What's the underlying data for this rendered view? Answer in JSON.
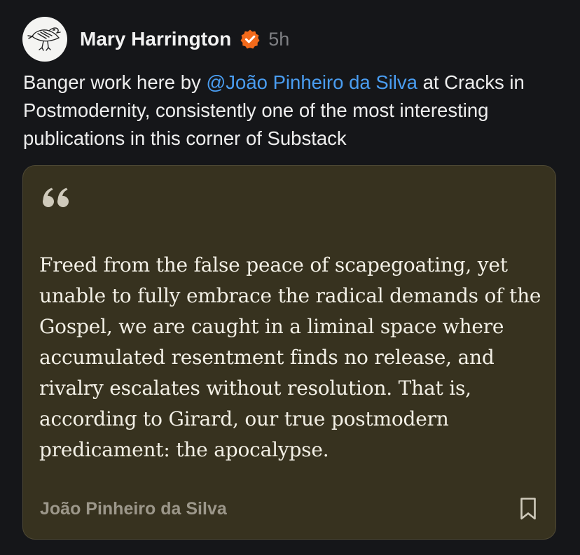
{
  "post": {
    "author": {
      "name": "Mary Harrington",
      "avatar_icon": "bird-drawing-icon",
      "verified_icon": "verified-check-icon",
      "verified_color": "#f26a1b"
    },
    "timestamp": "5h",
    "body": {
      "prefix": "Banger work here by ",
      "mention": "@João Pinheiro da Silva",
      "suffix": " at Cracks in Postmodernity, consistently one of the most interesting publications in this corner of Substack",
      "mention_color": "#4a9df1"
    },
    "quote": {
      "quote_icon": "quotation-mark-icon",
      "text": "Freed from the false peace of scapegoating, yet unable to fully embrace the radical demands of the Gospel, we are caught in a liminal space where accumulated resentment finds no release, and rivalry escalates without resolution. That is, according to Girard, our true postmodern predicament: the apocalypse.",
      "author": "João Pinheiro da Silva",
      "bookmark_icon": "bookmark-icon",
      "background_color": "#37321f"
    }
  }
}
